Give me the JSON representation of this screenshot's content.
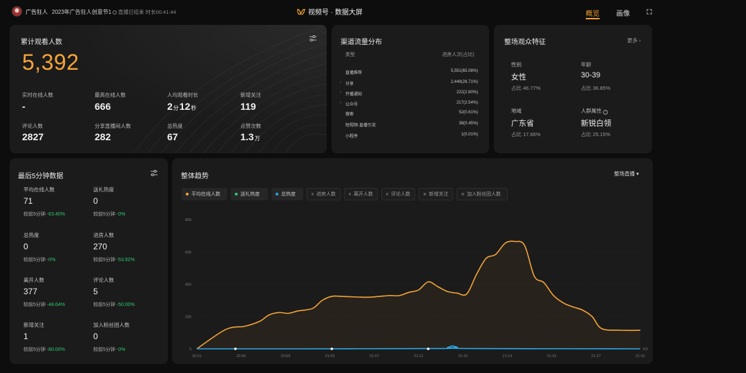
{
  "header": {
    "account_name": "广告狂人",
    "live_title": "2023年广告狂人创意节1",
    "live_status": "直播已结束 时长00:41:44",
    "brand_title": "视频号 · 数据大屏",
    "tabs": [
      {
        "label": "概览",
        "active": true
      },
      {
        "label": "画像",
        "active": false
      }
    ],
    "accent_color": "#f0a030"
  },
  "overview": {
    "title": "累计观看人数",
    "total_viewers": "5,392",
    "metrics": [
      {
        "label": "实时在线人数",
        "value": "-"
      },
      {
        "label": "最高在线人数",
        "value": "666"
      },
      {
        "label": "人均观看时长",
        "value_min": "2",
        "unit_min": "分",
        "value_sec": "12",
        "unit_sec": "秒"
      },
      {
        "label": "新增关注",
        "value": "119"
      },
      {
        "label": "评论人数",
        "value": "2827"
      },
      {
        "label": "分享直播间人数",
        "value": "282"
      },
      {
        "label": "总热度",
        "value": "67"
      },
      {
        "label": "点赞次数",
        "value": "1.3",
        "unit": "万"
      }
    ]
  },
  "channel": {
    "title": "渠道流量分布",
    "col_type": "类型",
    "col_value": "进房人次(占比)",
    "rows": [
      {
        "name": "直播推荐",
        "value": "5,551(65.08%)",
        "expandable": false
      },
      {
        "name": "分享",
        "value": "2,449(28.71%)",
        "expandable": true
      },
      {
        "name": "开播通知",
        "value": "222(2.60%)",
        "expandable": true
      },
      {
        "name": "公众号",
        "value": "217(2.54%)",
        "expandable": true
      },
      {
        "name": "搜索",
        "value": "52(0.61%)",
        "expandable": false
      },
      {
        "name": "短视频-直播引流",
        "value": "38(0.45%)",
        "expandable": false
      },
      {
        "name": "小程序",
        "value": "1(0.01%)",
        "expandable": false
      }
    ]
  },
  "audience": {
    "title": "整场观众特征",
    "more": "更多 ›",
    "features": [
      {
        "label": "性别",
        "value": "女性",
        "ratio": "占比 46.77%"
      },
      {
        "label": "年龄",
        "value": "30-39",
        "ratio": "占比 36.85%"
      },
      {
        "label": "地域",
        "value": "广东省",
        "ratio": "占比 17.66%"
      },
      {
        "label": "人群属性",
        "value": "新锐白领",
        "ratio": "占比 25.15%"
      }
    ]
  },
  "last5": {
    "title": "最后5分钟数据",
    "compare_prefix": "较前5分钟",
    "items": [
      {
        "label": "平均在线人数",
        "value": "71",
        "change": "-63.40%"
      },
      {
        "label": "送礼热度",
        "value": "0",
        "change": "-0%"
      },
      {
        "label": "总热度",
        "value": "0",
        "change": "-0%"
      },
      {
        "label": "进房人数",
        "value": "270",
        "change": "-53.92%"
      },
      {
        "label": "离开人数",
        "value": "377",
        "change": "-48.64%"
      },
      {
        "label": "评论人数",
        "value": "5",
        "change": "-50.00%"
      },
      {
        "label": "新增关注",
        "value": "1",
        "change": "-80.00%"
      },
      {
        "label": "加入粉丝团人数",
        "value": "0",
        "change": "-0%"
      }
    ],
    "change_color": "#2ecc71"
  },
  "trend": {
    "title": "整体趋势",
    "scope": "整场直播 ▾",
    "legend": [
      {
        "label": "平均在线人数",
        "color": "#f5a43a",
        "active": true
      },
      {
        "label": "送礼热度",
        "color": "#2ecc71",
        "active": true
      },
      {
        "label": "总热度",
        "color": "#2aa8e8",
        "active": true
      },
      {
        "label": "进房人数",
        "color": "#555555",
        "active": false
      },
      {
        "label": "离开人数",
        "color": "#555555",
        "active": false
      },
      {
        "label": "评论人数",
        "color": "#555555",
        "active": false
      },
      {
        "label": "新增关注",
        "color": "#555555",
        "active": false
      },
      {
        "label": "加入粉丝团人数",
        "color": "#555555",
        "active": false
      }
    ]
  },
  "chart_data": {
    "type": "line",
    "title": "",
    "xlabel": "",
    "ylabel": "",
    "ylim": [
      0,
      800
    ],
    "yticks": [
      0,
      200,
      400,
      600,
      800
    ],
    "y2_label": "K0",
    "x_tick_labels": [
      "20:51",
      "20:55",
      "20:59",
      "21:03",
      "21:07",
      "21:11",
      "21:15",
      "21:19",
      "21:23",
      "21:27",
      "21:31"
    ],
    "x_range_minutes": [
      0,
      44
    ],
    "grid": true,
    "series": [
      {
        "name": "平均在线人数",
        "color": "#f5a43a",
        "points": [
          [
            0,
            0
          ],
          [
            3,
            120
          ],
          [
            5,
            140
          ],
          [
            6.5,
            170
          ],
          [
            7.5,
            210
          ],
          [
            8.5,
            225
          ],
          [
            9.5,
            220
          ],
          [
            10.5,
            235
          ],
          [
            12,
            250
          ],
          [
            13,
            300
          ],
          [
            14,
            325
          ],
          [
            15,
            325
          ],
          [
            17,
            320
          ],
          [
            18,
            320
          ],
          [
            19,
            325
          ],
          [
            20,
            330
          ],
          [
            21,
            330
          ],
          [
            22,
            350
          ],
          [
            23,
            365
          ],
          [
            24,
            415
          ],
          [
            25,
            385
          ],
          [
            26,
            355
          ],
          [
            27,
            345
          ],
          [
            28,
            340
          ],
          [
            29,
            460
          ],
          [
            30,
            560
          ],
          [
            31,
            585
          ],
          [
            32,
            655
          ],
          [
            33,
            665
          ],
          [
            34,
            640
          ],
          [
            35,
            450
          ],
          [
            36,
            410
          ],
          [
            37,
            330
          ],
          [
            38,
            285
          ],
          [
            39,
            260
          ],
          [
            40,
            240
          ],
          [
            41,
            200
          ],
          [
            42,
            125
          ],
          [
            44,
            115
          ],
          [
            46,
            115
          ]
        ]
      },
      {
        "name": "总热度",
        "color": "#2aa8e8",
        "points": [
          [
            0,
            0
          ],
          [
            10,
            0
          ],
          [
            25,
            2
          ],
          [
            26,
            8
          ],
          [
            26.5,
            18
          ],
          [
            27,
            10
          ],
          [
            28,
            2
          ],
          [
            46,
            0
          ]
        ]
      }
    ],
    "markers": [
      [
        4,
        0
      ],
      [
        14,
        0
      ],
      [
        24,
        0
      ]
    ]
  }
}
